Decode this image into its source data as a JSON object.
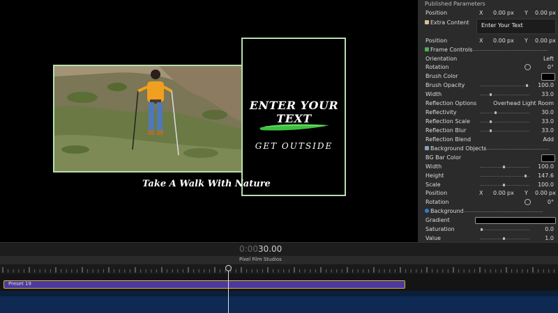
{
  "viewer": {
    "headline": "ENTER YOUR TEXT",
    "subline": "GET OUTSIDE",
    "caption": "Take A Walk With Nature",
    "frame_color": "#b7e0b0",
    "brush_color": "#3fbf3f"
  },
  "inspector": {
    "header": "Published Parameters",
    "position_1": {
      "label": "Position",
      "x_label": "X",
      "x_value": "0.00",
      "x_unit": "px",
      "y_label": "Y",
      "y_value": "0.00",
      "y_unit": "px"
    },
    "extra_content": {
      "label": "Extra Content",
      "value": "Enter Your Text"
    },
    "position_2": {
      "label": "Position",
      "x_label": "X",
      "x_value": "0.00",
      "x_unit": "px",
      "y_label": "Y",
      "y_value": "0.00",
      "y_unit": "px"
    },
    "frame_controls": {
      "title": "Frame Controls",
      "orientation": {
        "label": "Orientation",
        "value": "Left"
      },
      "rotation": {
        "label": "Rotation",
        "value": "0°"
      },
      "brush_color": {
        "label": "Brush Color"
      },
      "brush_opacity": {
        "label": "Brush Opacity",
        "value": "100.0"
      },
      "width": {
        "label": "Width",
        "value": "33.0"
      },
      "reflection_options": {
        "label": "Reflection Options",
        "value": "Overhead Light Room"
      },
      "reflectivity": {
        "label": "Reflectivity",
        "value": "30.0"
      },
      "reflection_scale": {
        "label": "Reflection Scale",
        "value": "33.0"
      },
      "reflection_blur": {
        "label": "Reflection Blur",
        "value": "33.0"
      },
      "reflection_blend": {
        "label": "Reflection Blend",
        "value": "Add"
      }
    },
    "background_objects": {
      "title": "Background Objects",
      "bg_bar_color": {
        "label": "BG Bar Color"
      },
      "width": {
        "label": "Width",
        "value": "100.0"
      },
      "height": {
        "label": "Height",
        "value": "147.6"
      },
      "scale": {
        "label": "Scale",
        "value": "100.0"
      },
      "position": {
        "label": "Position",
        "x_label": "X",
        "x_value": "0.00",
        "x_unit": "px",
        "y_label": "Y",
        "y_value": "0.00",
        "y_unit": "px"
      },
      "rotation": {
        "label": "Rotation",
        "value": "0°"
      }
    },
    "background": {
      "title": "Background",
      "gradient": {
        "label": "Gradient"
      },
      "saturation": {
        "label": "Saturation",
        "value": "0.0"
      },
      "value": {
        "label": "Value",
        "value": "1.0"
      }
    }
  },
  "timeline": {
    "timecode_dim": "0:00",
    "timecode": "30.00",
    "track_name": "Pixel Film Studios",
    "clip_label": "Preset 19"
  }
}
